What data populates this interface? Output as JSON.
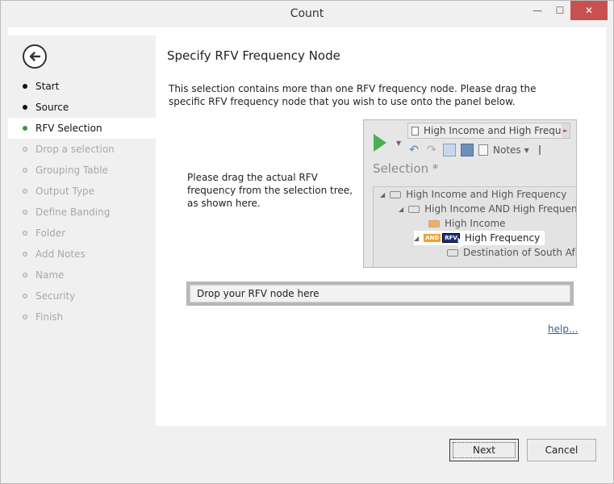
{
  "window": {
    "title": "Count",
    "minimize_label": "—",
    "maximize_label": "☐",
    "close_label": "✕"
  },
  "sidebar": {
    "back_icon": "back-arrow-icon",
    "items": [
      {
        "label": "Start",
        "state": "done"
      },
      {
        "label": "Source",
        "state": "done"
      },
      {
        "label": "RFV Selection",
        "state": "active"
      },
      {
        "label": "Drop a selection",
        "state": "pending"
      },
      {
        "label": "Grouping Table",
        "state": "pending"
      },
      {
        "label": "Output Type",
        "state": "pending"
      },
      {
        "label": "Define Banding",
        "state": "pending"
      },
      {
        "label": "Folder",
        "state": "pending"
      },
      {
        "label": "Add Notes",
        "state": "pending"
      },
      {
        "label": "Name",
        "state": "pending"
      },
      {
        "label": "Security",
        "state": "pending"
      },
      {
        "label": "Finish",
        "state": "pending"
      }
    ]
  },
  "main": {
    "heading": "Specify RFV Frequency Node",
    "description": "This selection contains more than one RFV frequency node. Please drag the specific RFV frequency node that you wish to use onto the panel below.",
    "instruction": "Please drag the actual RFV frequency from the selection tree, as shown here.",
    "preview": {
      "combo_text": "High Income and High Frequen",
      "notes_label": "Notes",
      "selection_label": "Selection *",
      "tree": [
        "High Income and High Frequency",
        "High Income AND High Frequency",
        "High Income",
        "High Frequency",
        "Destination of South Afric"
      ],
      "and_badge": "AND",
      "rfv_badge": "RFV"
    },
    "drop_placeholder": "Drop your RFV node here",
    "help_link": "help..."
  },
  "footer": {
    "next_label": "Next",
    "cancel_label": "Cancel"
  },
  "colors": {
    "active_dot": "#3c9a3c",
    "close_button": "#c75050",
    "link": "#3a5a9a"
  }
}
